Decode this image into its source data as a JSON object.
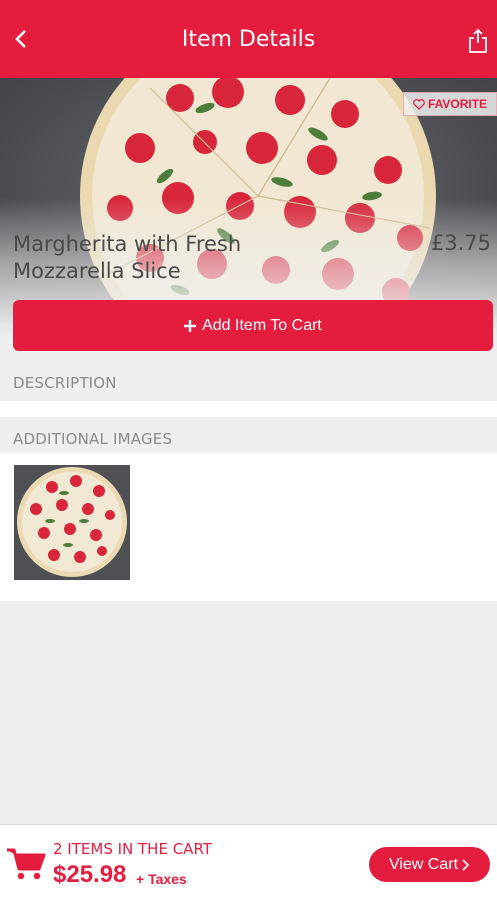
{
  "header": {
    "title": "Item Details",
    "back_icon": "chevron-left-icon",
    "share_icon": "share-icon"
  },
  "item": {
    "favorite_label": "FAVORITE",
    "name_line1": "Margherita with Fresh",
    "name_line2": "Mozzarella Slice",
    "price": "£3.75"
  },
  "actions": {
    "add_to_cart_label": "Add Item To Cart"
  },
  "sections": {
    "description": "DESCRIPTION",
    "additional_images": "ADDITIONAL IMAGES"
  },
  "cart": {
    "count_label": "2 ITEMS IN THE CART",
    "total": "$25.98",
    "taxes_label": "+ Taxes",
    "view_cart_label": "View Cart"
  },
  "colors": {
    "brand": "#e41d3f",
    "background": "#efefef"
  }
}
